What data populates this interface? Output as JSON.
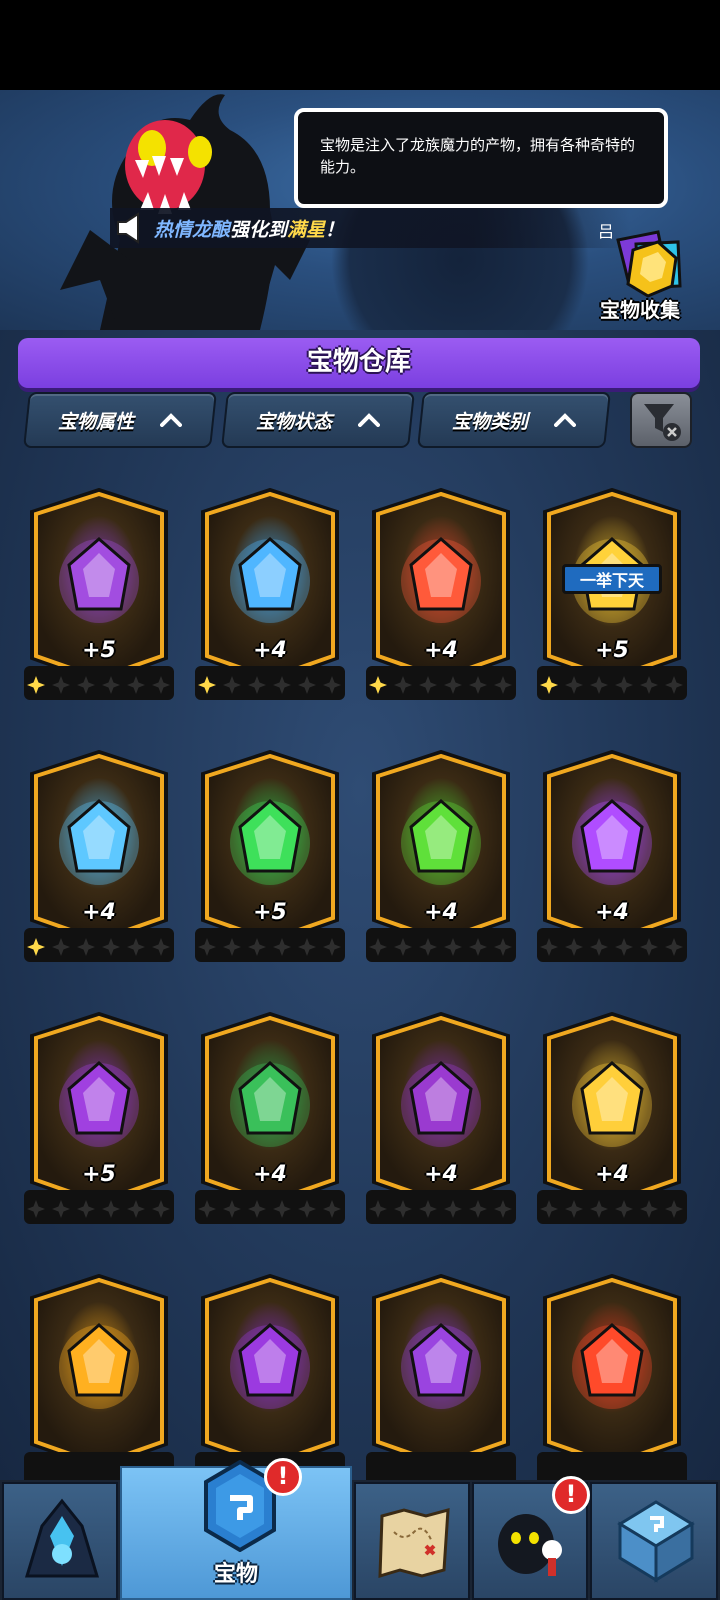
{
  "hero": {
    "tip_text": "宝物是注入了龙族魔力的产物，拥有各种奇特的能力。",
    "news": {
      "item_name": "热情龙酿",
      "mid_text": "强化到",
      "highlight": "满星",
      "end_text": "！",
      "trailing_glyph": "吕"
    },
    "collection_label": "宝物收集"
  },
  "warehouse": {
    "title": "宝物仓库",
    "filters": [
      {
        "label": "宝物属性"
      },
      {
        "label": "宝物状态"
      },
      {
        "label": "宝物类别"
      }
    ],
    "clear_filter_icon": "filter-clear-icon"
  },
  "treasures": [
    {
      "icon": "purple-chest-icon",
      "level": "+5",
      "stars": 1,
      "glow": "#a24de0"
    },
    {
      "icon": "ice-shield-icon",
      "level": "+4",
      "stars": 1,
      "glow": "#4fb6ff"
    },
    {
      "icon": "fire-cup-icon",
      "level": "+4",
      "stars": 1,
      "glow": "#ff5a3a"
    },
    {
      "icon": "golden-plaque-icon",
      "level": "+5",
      "stars": 1,
      "glow": "#ffd23a",
      "plaque_text": "一举下天"
    },
    {
      "icon": "frost-crystal-icon",
      "level": "+4",
      "stars": 1,
      "glow": "#5ec8ff"
    },
    {
      "icon": "green-orb-icon",
      "level": "+5",
      "stars": 0,
      "glow": "#3ee05a"
    },
    {
      "icon": "green-crown-icon",
      "level": "+4",
      "stars": 0,
      "glow": "#5fe03a"
    },
    {
      "icon": "purple-eye-icon",
      "level": "+4",
      "stars": 0,
      "glow": "#b04dff"
    },
    {
      "icon": "purple-key-icon",
      "level": "+5",
      "stars": 0,
      "glow": "#a040e0"
    },
    {
      "icon": "green-wing-icon",
      "level": "+4",
      "stars": 0,
      "glow": "#3ac05a"
    },
    {
      "icon": "purple-horn-icon",
      "level": "+4",
      "stars": 0,
      "glow": "#9a3ad0"
    },
    {
      "icon": "golden-doll-icon",
      "level": "+4",
      "stars": 0,
      "glow": "#ffcf3a"
    },
    {
      "icon": "golden-bat-wing-icon",
      "level": "",
      "stars": 0,
      "glow": "#ffb020"
    },
    {
      "icon": "purple-cube-icon",
      "level": "",
      "stars": 0,
      "glow": "#9b3ae0"
    },
    {
      "icon": "purple-scale-icon",
      "level": "",
      "stars": 0,
      "glow": "#9a44e0"
    },
    {
      "icon": "fire-pot-icon",
      "level": "",
      "stars": 0,
      "glow": "#ff4a2a"
    }
  ],
  "nav": {
    "tabs": [
      {
        "icon": "dragon-crystal-icon",
        "label": ""
      },
      {
        "icon": "treasure-gem-icon",
        "label": "宝物",
        "active": true,
        "alert": "!"
      },
      {
        "icon": "treasure-map-icon",
        "label": ""
      },
      {
        "icon": "dark-creature-icon",
        "label": "",
        "alert": "!"
      },
      {
        "icon": "house-icon",
        "label": ""
      }
    ]
  },
  "colors": {
    "title_bar": "#8b4df0",
    "card_border": "#f0a820",
    "background": "#22395a"
  }
}
